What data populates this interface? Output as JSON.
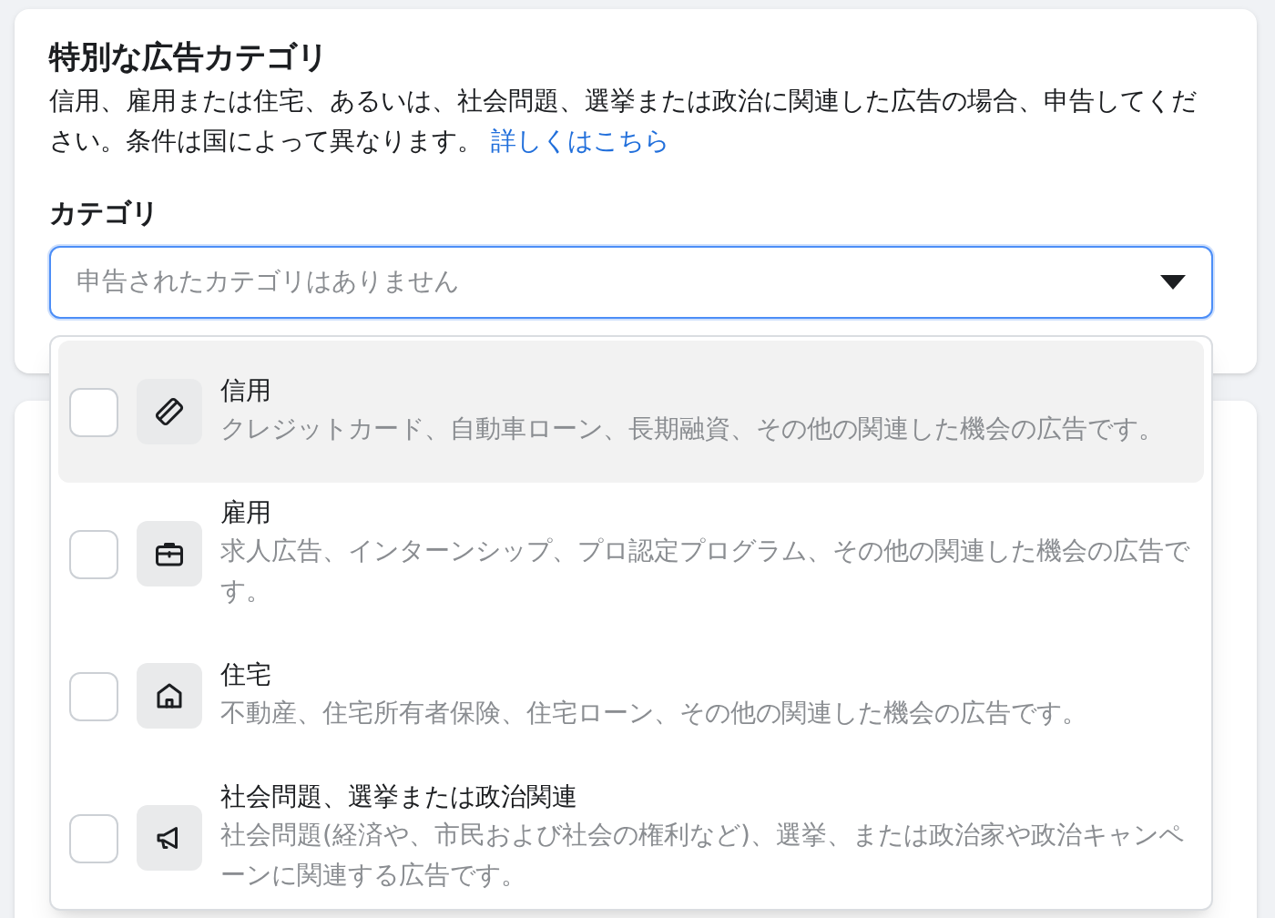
{
  "section": {
    "title": "特別な広告カテゴリ",
    "description": "信用、雇用または住宅、あるいは、社会問題、選挙または政治に関連した広告の場合、申告してください。条件は国によって異なります。",
    "link": "詳しくはこちら"
  },
  "category": {
    "label": "カテゴリ",
    "placeholder": "申告されたカテゴリはありません",
    "expanded": true
  },
  "options": [
    {
      "kind": "card",
      "title": "信用",
      "description": "クレジットカード、自動車ローン、長期融資、その他の関連した機会の広告です。",
      "checked": false,
      "highlighted": true
    },
    {
      "kind": "briefcase",
      "title": "雇用",
      "description": "求人広告、インターンシップ、プロ認定プログラム、その他の関連した機会の広告です。",
      "checked": false,
      "highlighted": false
    },
    {
      "kind": "house",
      "title": "住宅",
      "description": "不動産、住宅所有者保険、住宅ローン、その他の関連した機会の広告です。",
      "checked": false,
      "highlighted": false
    },
    {
      "kind": "megaphone",
      "title": "社会問題、選挙または政治関連",
      "description": "社会問題(経済や、市民および社会の権利など)、選挙、または政治家や政治キャンペーンに関連する広告です。",
      "checked": false,
      "highlighted": false
    }
  ]
}
